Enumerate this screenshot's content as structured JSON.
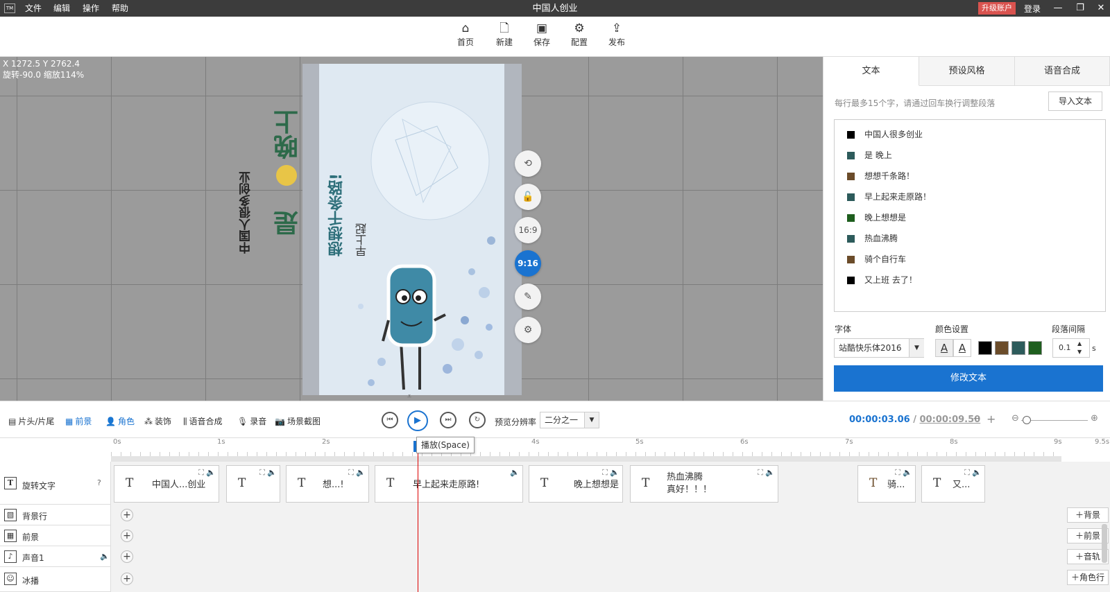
{
  "titlebar": {
    "logo": "TM",
    "menu": [
      "文件",
      "编辑",
      "操作",
      "帮助"
    ],
    "title": "中国人创业",
    "upgrade": "升级账户",
    "login": "登录"
  },
  "toolbar": {
    "home": "首页",
    "new": "新建",
    "save": "保存",
    "config": "配置",
    "publish": "发布"
  },
  "canvas": {
    "coord_line1": "X 1272.5 Y 2762.4",
    "coord_line2": "旋转-90.0 缩放114%",
    "preview_texts": [
      "中国人很多创业",
      "是",
      "晚上",
      "想想千条路!",
      "早上起"
    ],
    "side_buttons": {
      "ratio_169": "16:9",
      "ratio_916": "9:16"
    }
  },
  "right_panel": {
    "tabs": [
      "文本",
      "预设风格",
      "语音合成"
    ],
    "hint": "每行最多15个字，请通过回车换行调整段落",
    "import_btn": "导入文本",
    "lines": [
      {
        "text": "中国人很多创业",
        "color": "#000000"
      },
      {
        "text": "是  晚上",
        "color": "#2d5b5b"
      },
      {
        "text": "想想千条路！",
        "color": "#6b4c2a"
      },
      {
        "text": "早上起来走原路！",
        "color": "#2d5b5b"
      },
      {
        "text": "  晚上想想是",
        "color": "#1e5e1e"
      },
      {
        "text": "热血沸腾",
        "color": "#2d5b5b"
      },
      {
        "text": "骑个自行车",
        "color": "#6b4c2a"
      },
      {
        "text": "又上班  去了！",
        "color": "#000000"
      }
    ],
    "font_label": "字体",
    "font_value": "站酷快乐体2016",
    "color_label": "颜色设置",
    "spacing_label": "段落间隔",
    "spacing_value": "0.1",
    "spacing_unit": "s",
    "palette": [
      "#000000",
      "#6b4c2a",
      "#2d5b5b",
      "#1e5e1e"
    ],
    "modify_btn": "修改文本"
  },
  "controls": {
    "tabs": [
      "片头/片尾",
      "前景",
      "角色",
      "装饰",
      "语音合成",
      "录音",
      "场景截图"
    ],
    "res_label": "预览分辨率",
    "res_value": "二分之一",
    "time_current": "00:00:03.06",
    "time_sep": "/",
    "time_total": "00:00:09.50",
    "tooltip": "播放(Space)"
  },
  "timeline": {
    "ticks": [
      "0s",
      "1s",
      "2s",
      "3s",
      "4s",
      "5s",
      "6s",
      "7s",
      "8s",
      "9s",
      "9.5s"
    ],
    "tracks": [
      "旋转文字",
      "背景行",
      "前景",
      "声音1",
      "冰播"
    ],
    "clips": [
      "中国人...创业",
      "",
      "想...!",
      "早上起来走原路!",
      "晚上想想是",
      "热血沸腾",
      "真好！！！",
      "骑...",
      "又..."
    ],
    "right_buttons": [
      "背景",
      "前景",
      "音轨",
      "角色行"
    ]
  }
}
